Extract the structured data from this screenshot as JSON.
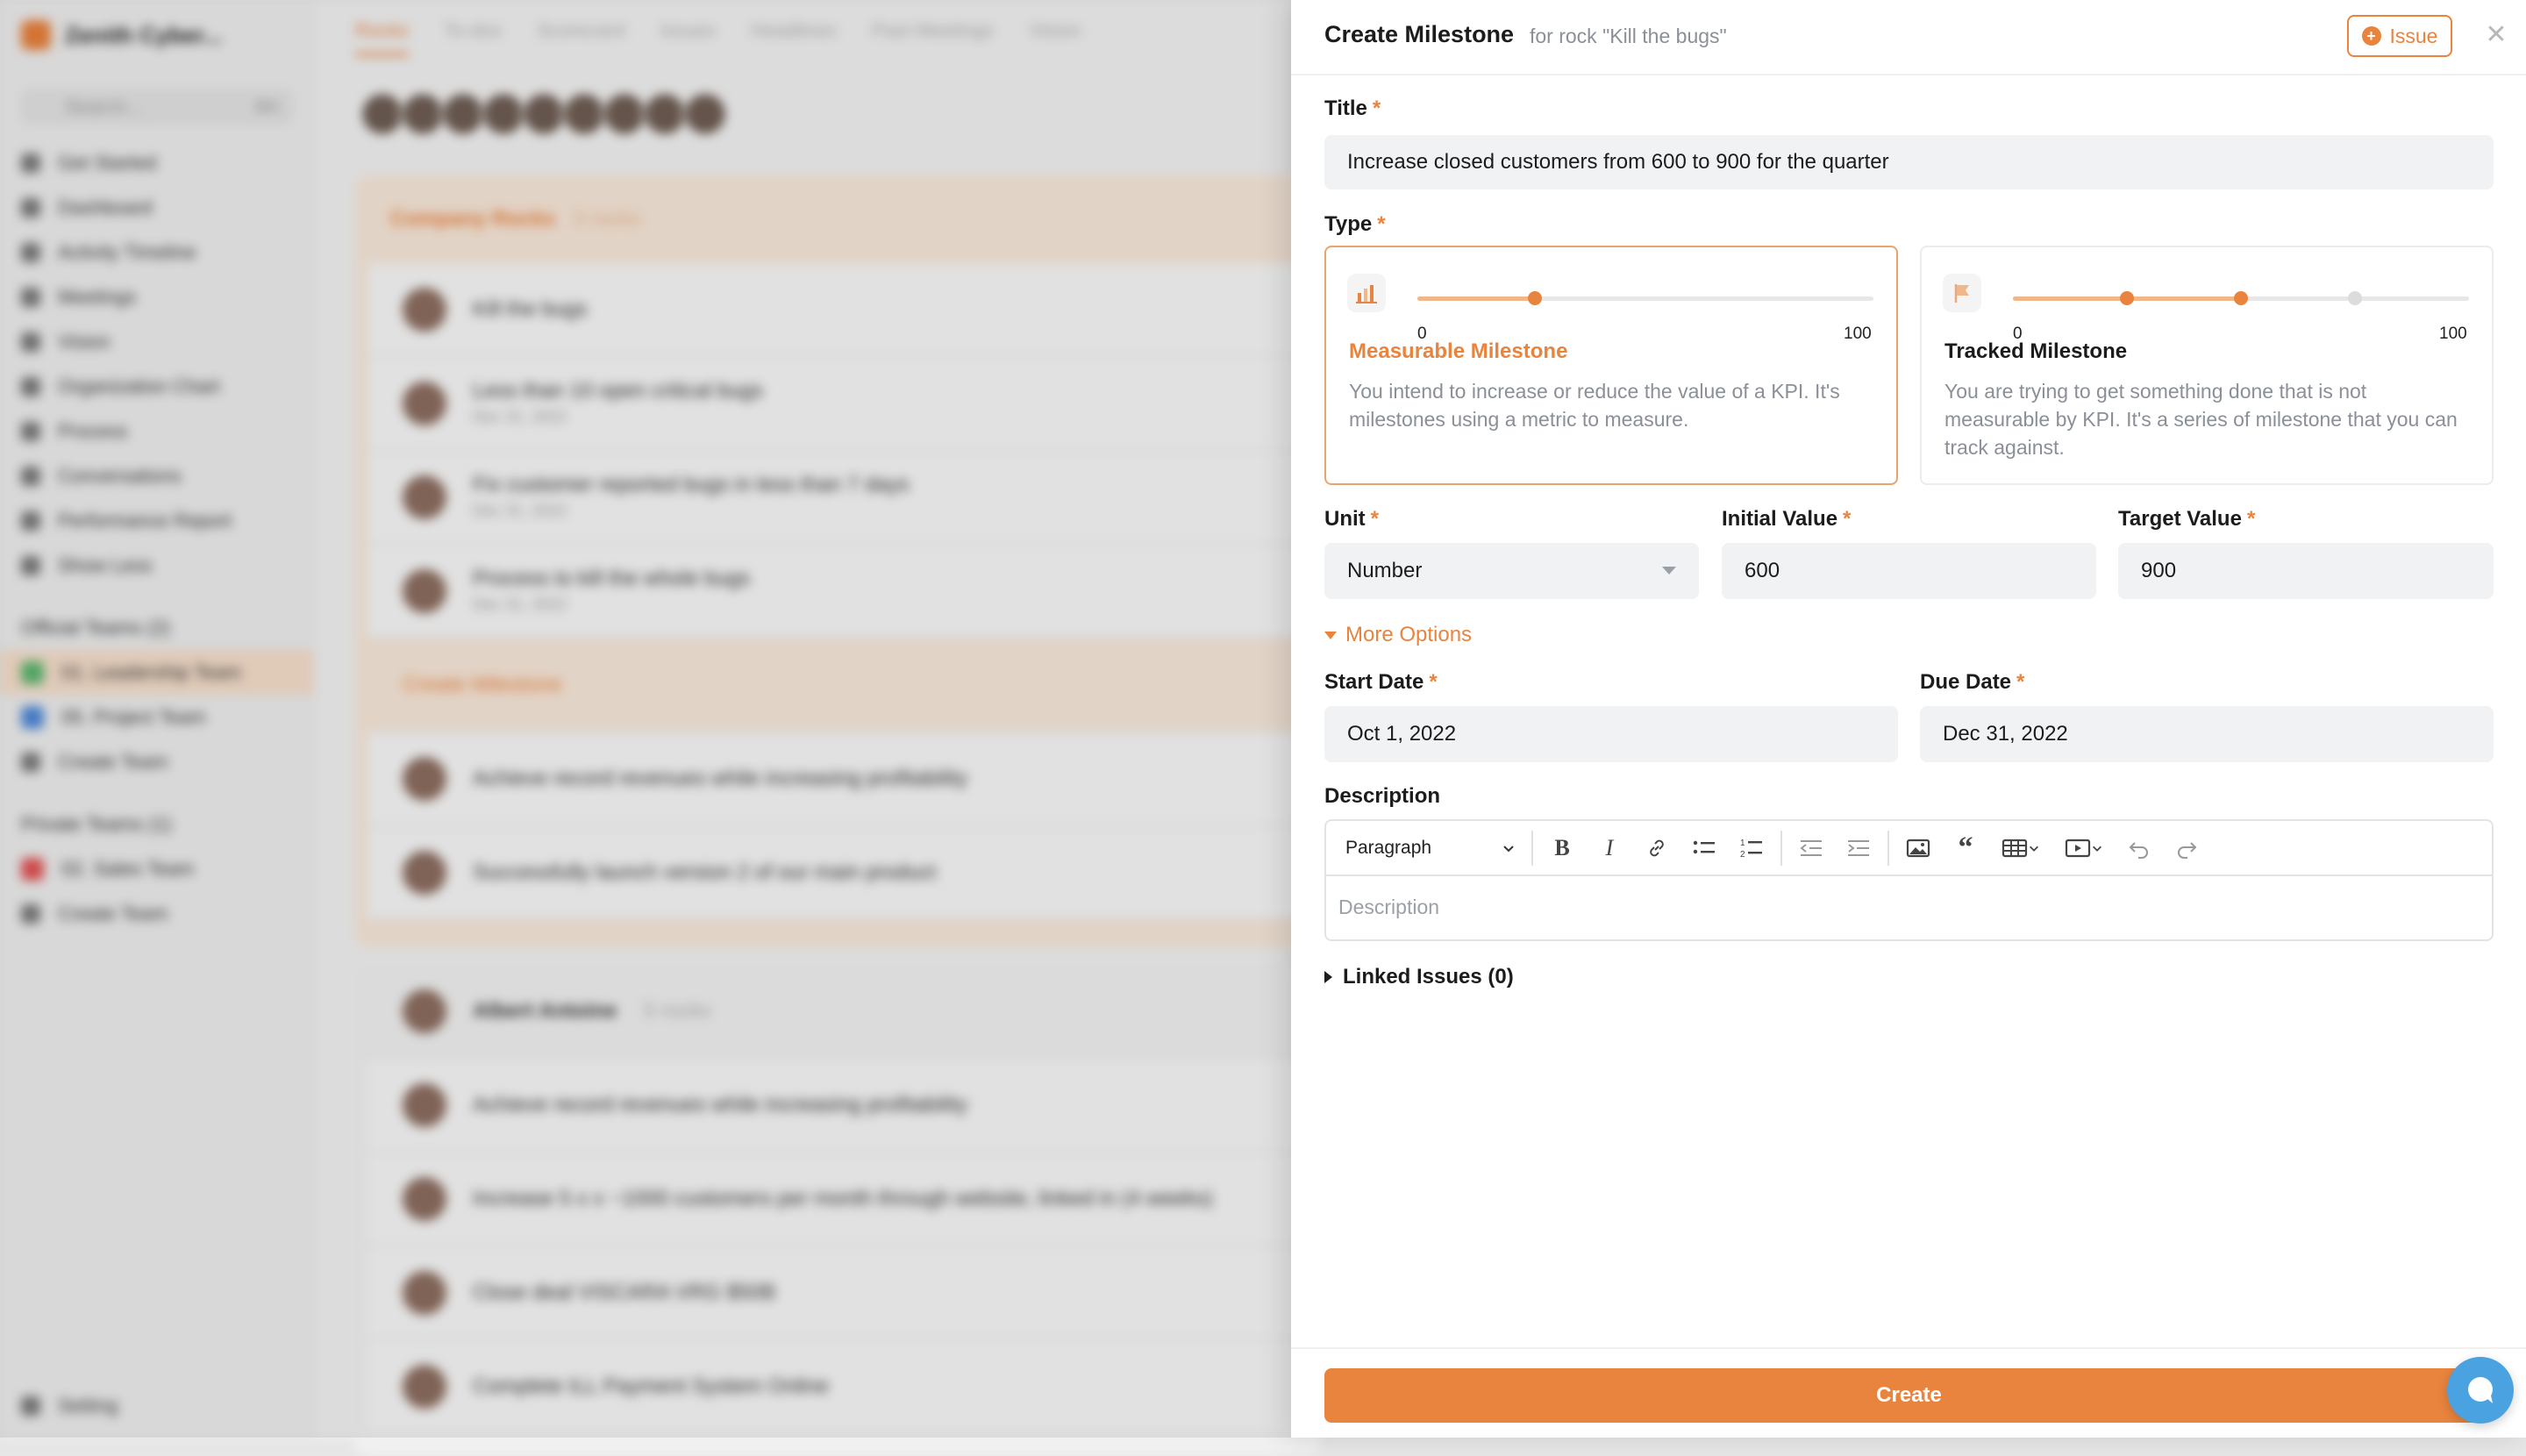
{
  "background": {
    "brand": "Zenith Cyber...",
    "search_placeholder": "Search...",
    "search_shortcut": "⌘K",
    "nav": [
      "Get Started",
      "Dashboard",
      "Activity Timeline",
      "Meetings",
      "Vision",
      "Organization Chart",
      "Process",
      "Conversations",
      "Performance Report",
      "Show Less"
    ],
    "official_teams_label": "Official Teams (2)",
    "teams": [
      "01. Leadership Team",
      "05. Project Team"
    ],
    "create_team": "Create Team",
    "private_teams_label": "Private Teams (1)",
    "private_teams": [
      "02. Sales Team"
    ],
    "setting": "Setting",
    "tabs": [
      "Rocks",
      "To-dos",
      "Scorecard",
      "Issues",
      "Headlines",
      "Past Meetings",
      "Vision"
    ],
    "section_title": "Company Rocks",
    "section_count": "3 rocks",
    "rows": [
      "Kill the bugs",
      "Less than 10 open critical bugs",
      "Fix customer reported bugs in less than 7 days",
      "Process to kill the whole bugs",
      "Create Milestone",
      "Achieve record revenues while increasing profitability",
      "Successfully launch version 2 of our main product"
    ],
    "row_dates": [
      "Dec 31, 2022",
      "Dec 31, 2022",
      "Dec 31, 2022"
    ],
    "section2_title": "Albert Antoine",
    "section2_count": "5 rocks",
    "rows2": [
      "Achieve record revenues while increasing profitability",
      "Increase 5 x x ~1000 customers per month through website, linked in (4 weeks)",
      "Close deal VISCARA VRG $50B",
      "Complete ILL Payment System Online"
    ]
  },
  "drawer": {
    "title": "Create Milestone",
    "subtitle": "for rock \"Kill the bugs\"",
    "issue_button": "Issue",
    "close_icon": "✕",
    "title_label": "Title",
    "title_value": "Increase closed customers from 600 to 900 for the quarter",
    "type_label": "Type",
    "types": [
      {
        "name": "Measurable Milestone",
        "description": "You intend to increase or reduce the value of a KPI. It's milestones using a metric to measure.",
        "min": "0",
        "max": "100",
        "selected": true,
        "icon": "chart-icon"
      },
      {
        "name": "Tracked Milestone",
        "description": "You are trying to get something done that is not measurable by KPI. It's a series of milestone that you can track against.",
        "min": "0",
        "max": "100",
        "selected": false,
        "icon": "flag-icon"
      }
    ],
    "unit_label": "Unit",
    "unit_value": "Number",
    "initial_label": "Initial Value",
    "initial_value": "600",
    "target_label": "Target Value",
    "target_value": "900",
    "more_options": "More Options",
    "start_label": "Start Date",
    "start_value": "Oct 1, 2022",
    "due_label": "Due Date",
    "due_value": "Dec 31, 2022",
    "description_label": "Description",
    "paragraph_select": "Paragraph",
    "description_placeholder": "Description",
    "linked_issues": "Linked Issues (0)",
    "create_button": "Create",
    "required_mark": "*"
  },
  "colors": {
    "accent": "#e8843e",
    "selected_border": "#eda46b",
    "chat": "#4aa3e0"
  }
}
